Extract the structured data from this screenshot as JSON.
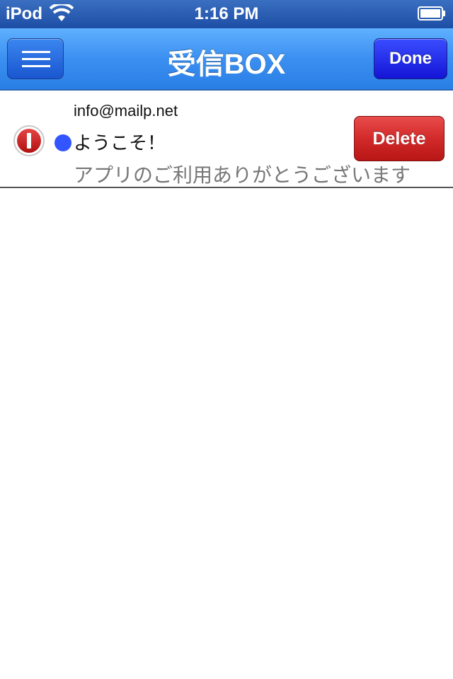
{
  "status_bar": {
    "carrier": "iPod",
    "time": "1:16 PM"
  },
  "nav_bar": {
    "title": "受信BOX",
    "done_label": "Done"
  },
  "mail": {
    "sender": "info@mailp.net",
    "subject": "ようこそ！",
    "preview": "アプリのご利用ありがとうございます",
    "delete_label": "Delete",
    "unread": true
  },
  "colors": {
    "nav_bar": "#3b8ff0",
    "done_button": "#1414d6",
    "delete_button": "#d22a2a",
    "unread_dot": "#3355ff"
  }
}
